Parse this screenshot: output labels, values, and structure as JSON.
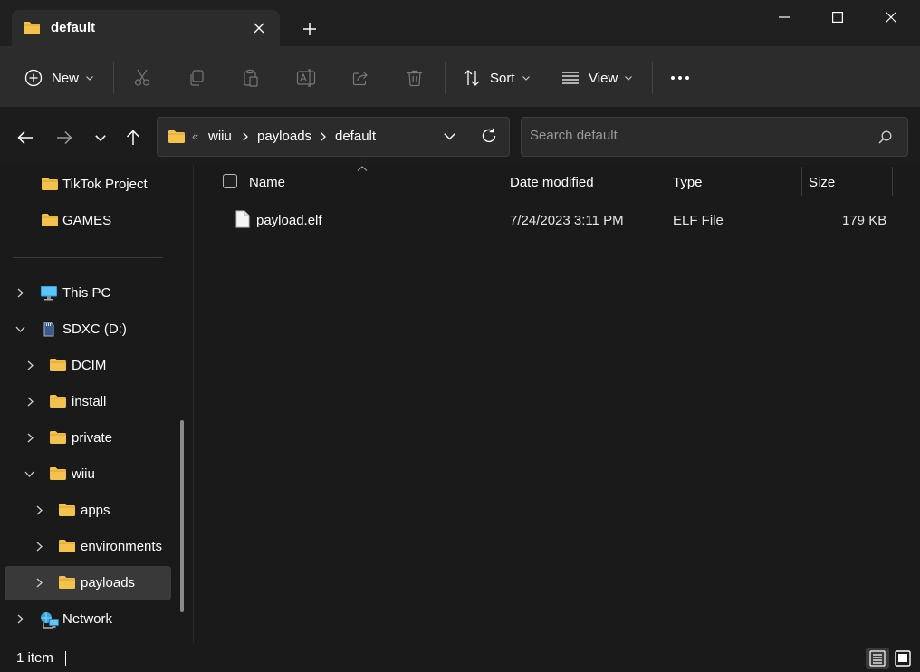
{
  "window": {
    "tab_title": "default",
    "controls": [
      "minimize",
      "maximize",
      "close"
    ]
  },
  "toolbar": {
    "new_label": "New",
    "sort_label": "Sort",
    "view_label": "View",
    "icons": [
      "cut-icon",
      "copy-icon",
      "paste-icon",
      "rename-icon",
      "share-icon",
      "delete-icon",
      "more-icon"
    ]
  },
  "address": {
    "overflow": "«",
    "crumbs": [
      "wiiu",
      "payloads",
      "default"
    ]
  },
  "search": {
    "placeholder": "Search default"
  },
  "sidebar": {
    "quick_access": [
      {
        "label": "TikTok Project"
      },
      {
        "label": "GAMES"
      }
    ],
    "tree": [
      {
        "label": "This PC"
      },
      {
        "label": "SDXC (D:)"
      },
      {
        "label": "DCIM"
      },
      {
        "label": "install"
      },
      {
        "label": "private"
      },
      {
        "label": "wiiu"
      },
      {
        "label": "apps"
      },
      {
        "label": "environments"
      },
      {
        "label": "payloads"
      },
      {
        "label": "Network"
      }
    ]
  },
  "files": {
    "columns": [
      "Name",
      "Date modified",
      "Type",
      "Size"
    ],
    "rows": [
      {
        "name": "payload.elf",
        "date": "7/24/2023 3:11 PM",
        "type": "ELF File",
        "size": "179 KB"
      }
    ]
  },
  "status": {
    "count": "1 item"
  },
  "colors": {
    "folder": "#f2c14e",
    "background": "#1a1a1a",
    "toolbar": "#2c2c2c"
  }
}
